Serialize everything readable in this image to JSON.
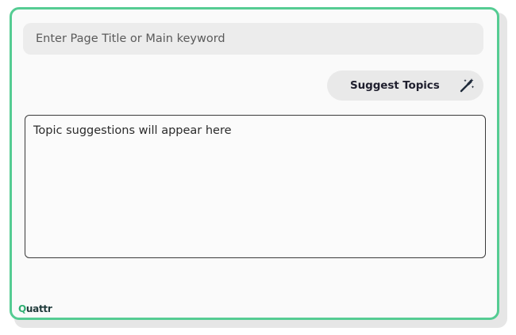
{
  "title_input": {
    "placeholder": "Enter Page Title or Main keyword",
    "value": ""
  },
  "suggest_button": {
    "label": "Suggest Topics",
    "icon": "magic-wand-icon"
  },
  "output": {
    "placeholder_text": "Topic suggestions will appear here"
  },
  "brand": {
    "logo_first": "Q",
    "logo_rest": "uattr"
  },
  "colors": {
    "accent_border": "#55cc93",
    "logo_accent": "#2fae72",
    "button_bg": "#e9e9e9",
    "input_bg": "#ececec"
  }
}
